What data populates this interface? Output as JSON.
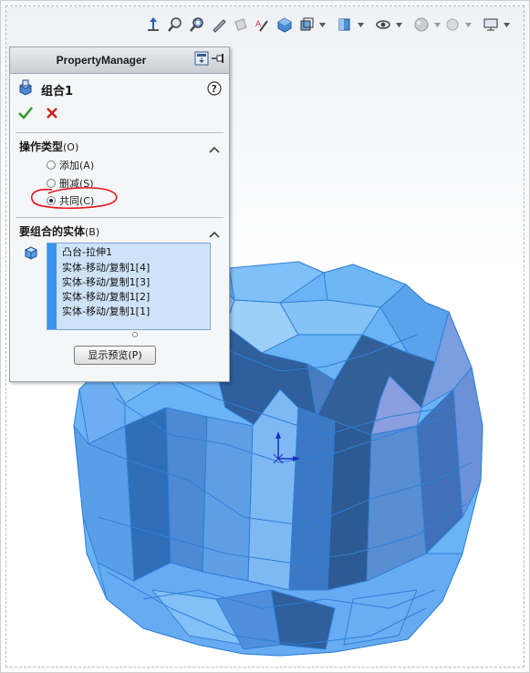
{
  "property_manager": {
    "title": "PropertyManager",
    "feature_name": "组合1",
    "operation_section": {
      "title": "操作类型",
      "accelerator": "(O)",
      "options": [
        {
          "label": "添加(A)",
          "selected": false
        },
        {
          "label": "删减(S)",
          "selected": false
        },
        {
          "label": "共同(C)",
          "selected": true
        }
      ]
    },
    "bodies_section": {
      "title": "要组合的实体",
      "accelerator": "(B)",
      "items": [
        "凸台-拉伸1",
        "实体-移动/复制1[4]",
        "实体-移动/复制1[3]",
        "实体-移动/复制1[2]",
        "实体-移动/复制1[1]"
      ]
    },
    "preview_button": "显示预览(P)"
  },
  "toolbar": {
    "icons": [
      "reference-axis-icon",
      "zoom-to-fit-icon",
      "zoom-to-area-icon",
      "previous-view-icon",
      "section-view-icon",
      "dynamic-annotation-view-icon",
      "view-orientation-icon",
      "display-style-icon",
      "hide-show-items-icon",
      "edit-appearance-icon",
      "apply-scene-icon",
      "view-settings-icon"
    ]
  },
  "colors": {
    "model_fill": "#5aa9f2",
    "model_edge": "#2f7fd8",
    "annotation_red": "#e8141a",
    "list_selection": "#cfe3f8"
  }
}
